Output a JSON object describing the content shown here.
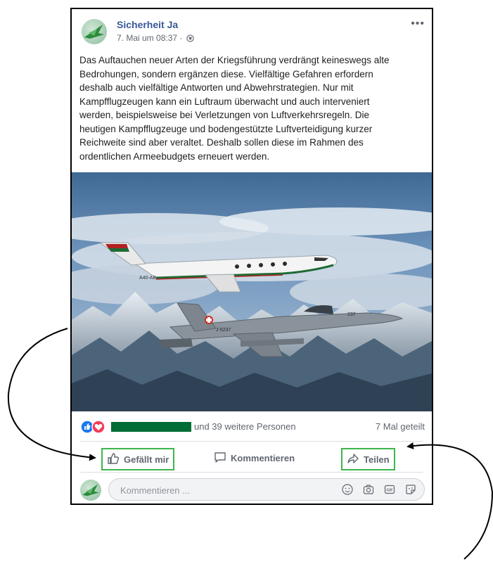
{
  "post": {
    "page_name": "Sicherheit Ja",
    "timestamp": "7. Mai um 08:37 ·",
    "more_label": "•••",
    "text_lines": [
      "Das Auftauchen neuer Arten der Kriegsführung verdrängt keineswegs alte",
      "Bedrohungen, sondern ergänzen diese. Vielfältige Gefahren erfordern",
      "deshalb auch vielfältige Antworten und Abwehrstrategien. Nur mit",
      "Kampfflugzeugen kann ein Luftraum überwacht und auch interveniert",
      "werden, beispielsweise bei Verletzungen von Luftverkehrsregeln. Die",
      "heutigen Kampfflugzeuge und bodengestützte Luftverteidigung kurzer",
      "Reichweite sind aber veraltet. Deshalb sollen diese im Rahmen des",
      "ordentlichen Armeebudgets erneuert werden."
    ],
    "image": {
      "jet_tail": "A40-AB",
      "fighter_code": "J-5237",
      "fighter_tail": "237"
    },
    "reactions_text": "und 39 weitere Personen",
    "shares_text": "7 Mal geteilt",
    "actions": {
      "like": "Gefällt mir",
      "comment": "Kommentieren",
      "share": "Teilen"
    },
    "comment_placeholder": "Kommentieren ...",
    "comment_icons": [
      "smiley-icon",
      "camera-icon",
      "gif-icon",
      "sticker-icon"
    ],
    "gif_label": "GIF"
  },
  "colors": {
    "link": "#385898",
    "highlight": "#3cb64c",
    "redaction": "#006c36",
    "like_blue": "#1877f2",
    "love_red": "#f33e58"
  }
}
